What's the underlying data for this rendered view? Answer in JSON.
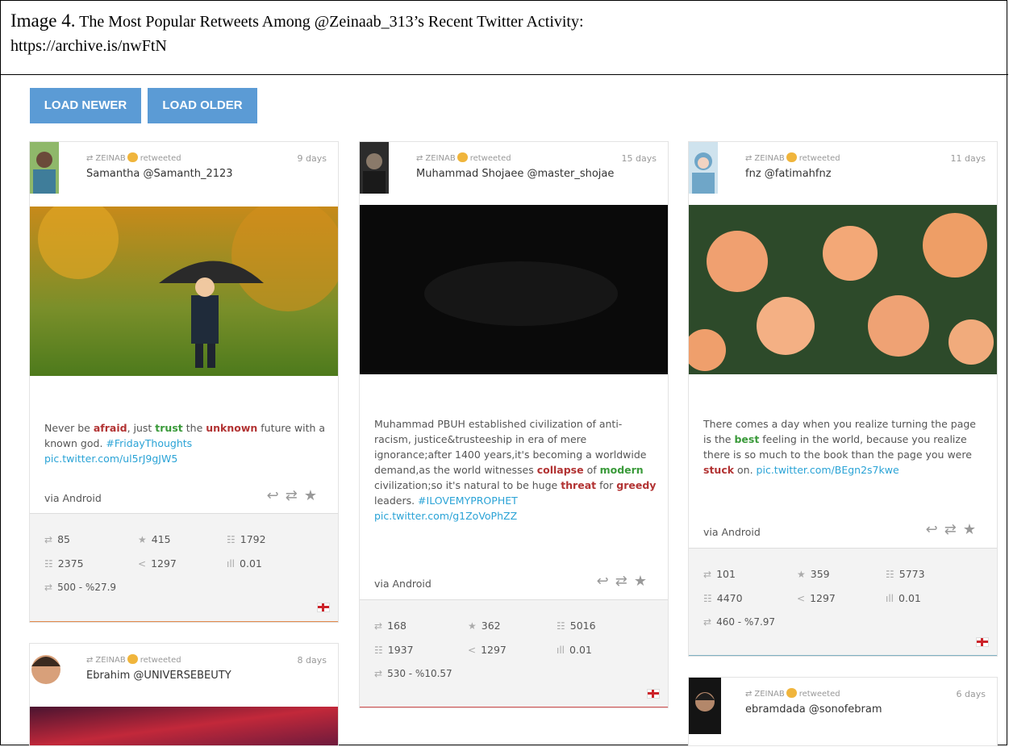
{
  "caption": {
    "label": "Image 4.",
    "title": " The Most Popular Retweets Among @Zeinaab_313’s Recent Twitter Activity:",
    "url": "https://archive.is/nwFtN"
  },
  "toolbar": {
    "load_newer": "LOAD NEWER",
    "load_older": "LOAD OLDER"
  },
  "retweet_tag": {
    "user": "ZEINAB",
    "label": "retweeted"
  },
  "cards": [
    {
      "days": "9 days",
      "author": "Samantha @Samanth_2123",
      "text_parts": [
        "Never be ",
        "afraid",
        ", just ",
        "trust",
        " the ",
        "unknown",
        " future with a known god. ",
        "#FridayThoughts pic.twitter.com/ul5rJ9gJW5"
      ],
      "via": "via Android",
      "stats": {
        "retweets": "85",
        "favorites": "415",
        "reach": "1792",
        "followers": "2375",
        "shares": "1297",
        "ratio": "0.01",
        "summary": "500 - %27.9"
      }
    },
    {
      "days": "15 days",
      "author": "Muhammad Shojaee @master_shojae",
      "text_parts": [
        "Muhammad PBUH established civilization of anti-racism, justice&trusteeship in era of mere ignorance;after 1400 years,it's becoming a worldwide demand,as the world witnesses ",
        "collapse",
        " of ",
        "modern",
        " civilization;so it's natural to be huge ",
        "threat",
        " for ",
        "greedy",
        " leaders. ",
        "#ILOVEMYPROPHET pic.twitter.com/g1ZoVoPhZZ"
      ],
      "via": "via Android",
      "stats": {
        "retweets": "168",
        "favorites": "362",
        "reach": "5016",
        "followers": "1937",
        "shares": "1297",
        "ratio": "0.01",
        "summary": "530 - %10.57"
      }
    },
    {
      "days": "11 days",
      "author": "fnz @fatimahfnz",
      "text_parts": [
        "There comes a day when you realize turning the page is the ",
        "best",
        " feeling in the world, because you realize there is so much to the book than the page you were ",
        "stuck",
        " on. ",
        "pic.twitter.com/BEgn2s7kwe"
      ],
      "via": "via Android",
      "stats": {
        "retweets": "101",
        "favorites": "359",
        "reach": "5773",
        "followers": "4470",
        "shares": "1297",
        "ratio": "0.01",
        "summary": "460 - %7.97"
      }
    },
    {
      "days": "8 days",
      "author": "Ebrahim @UNIVERSEBEUTY"
    },
    {
      "days": "6 days",
      "author": "ebramdada @sonofebram"
    }
  ],
  "icons": {
    "retweet": "retweet-icon",
    "favorite": "star-icon",
    "reply": "reply-icon",
    "reach": "people-icon",
    "share": "share-icon",
    "ratio": "bar-chart-icon",
    "flag": "england-flag-icon"
  }
}
